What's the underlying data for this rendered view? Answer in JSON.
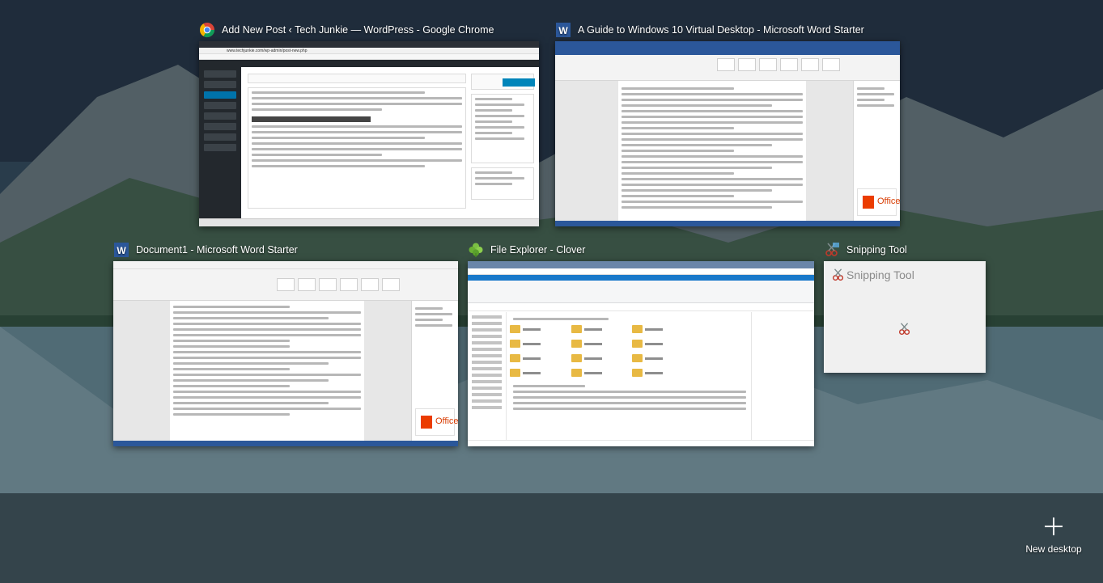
{
  "windows": {
    "chrome": {
      "title": "Add New Post ‹ Tech Junkie — WordPress - Google Chrome",
      "icon": "chrome-icon",
      "url": "www.techjunkie.com/wp-admin/post-new.php"
    },
    "word_guide": {
      "title": "A Guide to Windows 10 Virtual Desktop - Microsoft Word Starter",
      "icon": "word-icon",
      "ad_text": "Office"
    },
    "word_doc1": {
      "title": "Document1 - Microsoft Word Starter",
      "icon": "word-icon",
      "ad_text": "Office"
    },
    "explorer": {
      "title": "File Explorer - Clover",
      "icon": "clover-icon"
    },
    "snipping": {
      "title": "Snipping Tool",
      "icon": "snipping-tool-icon",
      "inner_title": "Snipping Tool"
    }
  },
  "new_desktop": {
    "label": "New desktop",
    "icon": "plus-icon"
  },
  "colors": {
    "word_blue": "#2b579a",
    "wp_dark": "#23282d",
    "explorer_blue": "#1979ca",
    "office_orange": "#eb3c00"
  }
}
